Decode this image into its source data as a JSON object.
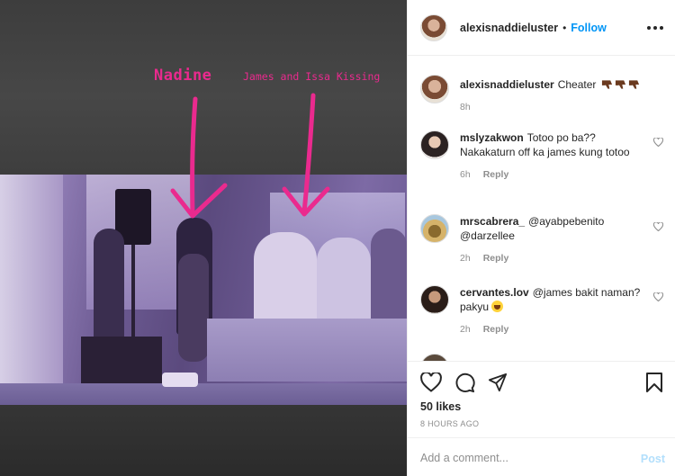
{
  "media": {
    "label_nadine": "Nadine",
    "label_james": "James and Issa Kissing"
  },
  "post": {
    "author": "alexisnaddieluster",
    "separator": "•",
    "follow_label": "Follow",
    "more_icon": "more-horizontal-icon"
  },
  "comments": [
    {
      "username": "alexisnaddieluster",
      "text": "Cheater",
      "time": "8h",
      "reply_label": "",
      "emoji": "thumbs-down-x3"
    },
    {
      "username": "mslyzakwon",
      "text": "Totoo po ba?? Nakakaturn off ka james kung totoo",
      "time": "6h",
      "reply_label": "Reply"
    },
    {
      "username": "mrscabrera_",
      "text": "@ayabpebenito @darzellee",
      "time": "2h",
      "reply_label": "Reply"
    },
    {
      "username": "cervantes.lov",
      "text": "@james bakit naman? pakyu",
      "time": "2h",
      "reply_label": "Reply",
      "emoji": "crying-face"
    }
  ],
  "actions": {
    "likes": "50 likes",
    "time_ago": "8 HOURS AGO",
    "icons": [
      "heart-icon",
      "comment-icon",
      "share-icon",
      "bookmark-icon"
    ]
  },
  "add_comment": {
    "placeholder": "Add a comment...",
    "post_label": "Post"
  },
  "colors": {
    "accent": "#0095f6",
    "overlay_pink": "#ea2a8e",
    "post_disabled": "#b2dffc"
  }
}
